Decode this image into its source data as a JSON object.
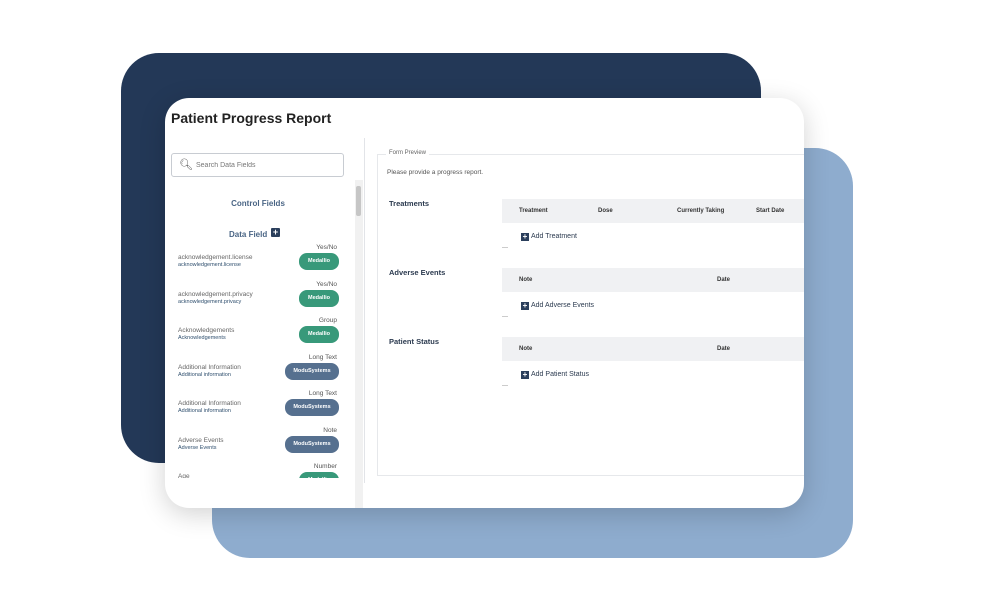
{
  "colors": {
    "backdrop_dark": "#233857",
    "backdrop_light": "#8eacce",
    "accent_green": "#38997a",
    "accent_slate": "#56708f"
  },
  "header": {
    "title": "Patient Progress Report"
  },
  "sidebar": {
    "search_placeholder": "Search Data Fields",
    "control_fields": "Control Fields",
    "data_field": "Data Field",
    "fields": [
      {
        "type": "Yes/No",
        "name": "acknowledgement.license",
        "key": "acknowledgement.license",
        "source": "Medallio",
        "style": "medallio"
      },
      {
        "type": "Yes/No",
        "name": "acknowledgement.privacy",
        "key": "acknowledgement.privacy",
        "source": "Medallio",
        "style": "medallio"
      },
      {
        "type": "Group",
        "name": "Acknowledgements",
        "key": "Acknowledgements",
        "source": "Medallio",
        "style": "medallio"
      },
      {
        "type": "Long Text",
        "name": "Additional Information",
        "key": "Additional information",
        "source": "ModuSystems",
        "style": "systems"
      },
      {
        "type": "Long Text",
        "name": "Additional Information",
        "key": "Additional information",
        "source": "ModuSystems",
        "style": "systems"
      },
      {
        "type": "Note",
        "name": "Adverse Events",
        "key": "Adverse Events",
        "source": "ModuSystems",
        "style": "systems"
      },
      {
        "type": "Number",
        "name": "Age",
        "key": "Age",
        "source": "Medallio",
        "style": "medallio"
      }
    ]
  },
  "preview": {
    "legend": "Form Preview",
    "intro": "Please provide a progress report.",
    "treatments": {
      "label": "Treatments",
      "columns": [
        "Treatment",
        "Dose",
        "Currently Taking",
        "Start Date"
      ],
      "add": "Add Treatment"
    },
    "adverse": {
      "label": "Adverse Events",
      "columns": [
        "Note",
        "Date"
      ],
      "add": "Add Adverse Events"
    },
    "status": {
      "label": "Patient Status",
      "columns": [
        "Note",
        "Date"
      ],
      "add": "Add Patient Status"
    }
  }
}
